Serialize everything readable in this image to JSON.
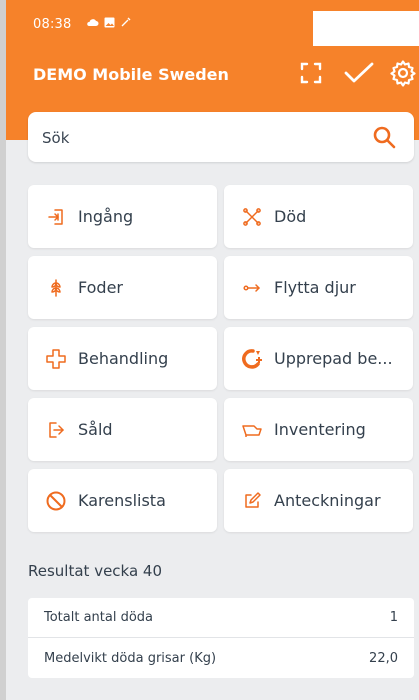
{
  "status_bar": {
    "time": "08:38"
  },
  "header": {
    "title": "DEMO Mobile Sweden"
  },
  "search": {
    "placeholder": "Sök"
  },
  "colors": {
    "accent": "#f6822a",
    "icon": "#ef6b1f"
  },
  "tiles": [
    {
      "label": "Ingång",
      "icon": "entrance-icon"
    },
    {
      "label": "Död",
      "icon": "cross-bones-icon"
    },
    {
      "label": "Foder",
      "icon": "grain-icon"
    },
    {
      "label": "Flytta djur",
      "icon": "move-arrow-icon"
    },
    {
      "label": "Behandling",
      "icon": "medical-cross-icon"
    },
    {
      "label": "Upprepad be...",
      "icon": "repeat-treatment-icon"
    },
    {
      "label": "Såld",
      "icon": "exit-icon"
    },
    {
      "label": "Inventering",
      "icon": "inventory-icon"
    },
    {
      "label": "Karenslista",
      "icon": "prohibited-icon"
    },
    {
      "label": "Anteckningar",
      "icon": "edit-note-icon"
    }
  ],
  "results": {
    "title": "Resultat vecka 40",
    "rows": [
      {
        "label": "Totalt antal döda",
        "value": "1"
      },
      {
        "label": "Medelvikt döda grisar (Kg)",
        "value": "22,0"
      }
    ]
  }
}
